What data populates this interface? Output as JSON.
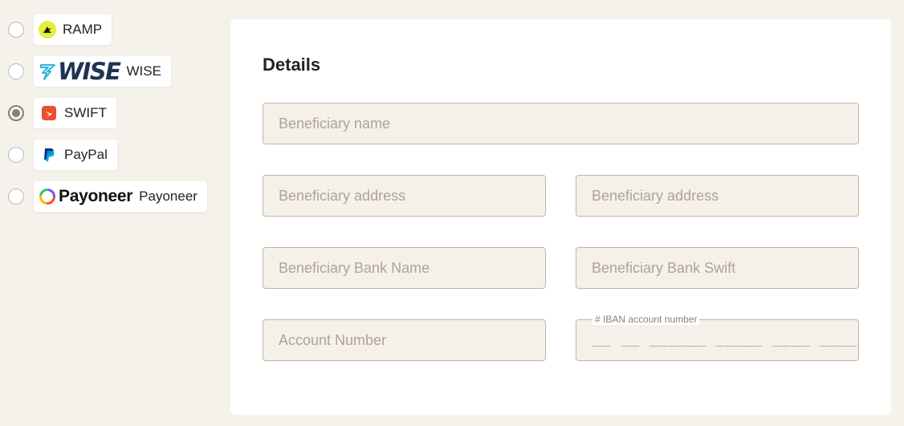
{
  "payment_methods": [
    {
      "id": "ramp",
      "label": "RAMP",
      "selected": false
    },
    {
      "id": "wise",
      "label": "WISE",
      "logo_text": "WISE",
      "selected": false
    },
    {
      "id": "swift",
      "label": "SWIFT",
      "selected": true
    },
    {
      "id": "paypal",
      "label": "PayPal",
      "selected": false
    },
    {
      "id": "payoneer",
      "label": "Payoneer",
      "logo_text": "Payoneer",
      "selected": false
    }
  ],
  "details": {
    "title": "Details",
    "fields": {
      "beneficiary_name": {
        "placeholder": "Beneficiary name",
        "value": ""
      },
      "beneficiary_address_1": {
        "placeholder": "Beneficiary address",
        "value": ""
      },
      "beneficiary_address_2": {
        "placeholder": "Beneficiary address",
        "value": ""
      },
      "bank_name": {
        "placeholder": "Beneficiary Bank Name",
        "value": ""
      },
      "bank_swift": {
        "placeholder": "Beneficiary Bank Swift",
        "value": ""
      },
      "account_number": {
        "placeholder": "Account Number",
        "value": ""
      },
      "iban": {
        "label": "# IBAN account number",
        "mask": "__ __ ______ _____ ____ ____",
        "value": ""
      }
    }
  },
  "colors": {
    "page_background": "#f5f2ec",
    "panel_background": "#ffffff",
    "field_background": "#f5f1ea",
    "field_border": "#c4b39f",
    "placeholder": "#b1a392",
    "radio_selected": "#8c7f6b",
    "ramp_brand": "#e4f03a",
    "wise_brand": "#1f3353",
    "wise_accent": "#2fb5d6",
    "swift_brand": "#e8502f",
    "paypal_brand": "#003087"
  },
  "icons": {
    "ramp": "ramp-logo-icon",
    "wise": "wise-logo-icon",
    "swift": "swift-logo-icon",
    "paypal": "paypal-logo-icon",
    "payoneer": "payoneer-logo-icon"
  }
}
